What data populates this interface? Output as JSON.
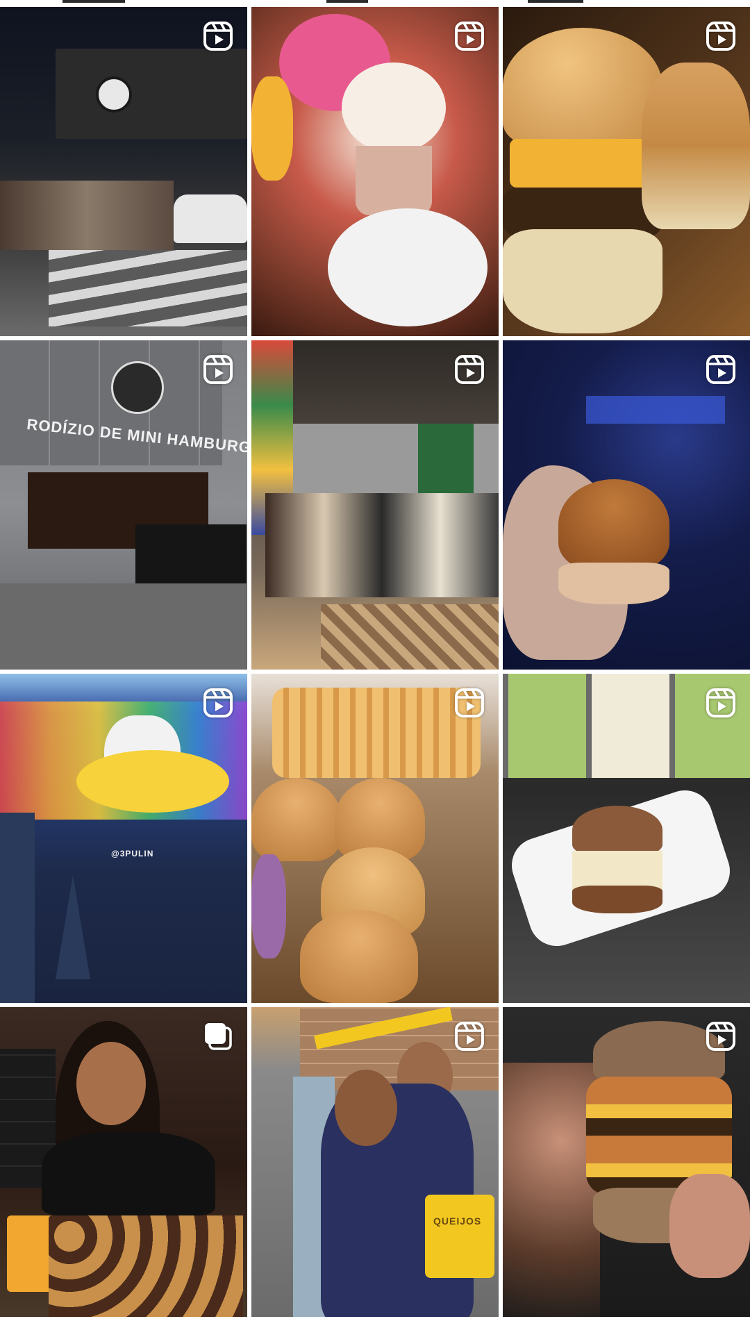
{
  "app": "Instagram profile reels grid",
  "grid": {
    "columns": 3,
    "tiles": [
      {
        "name": "tile-storefront-night",
        "badge": "reels-icon",
        "colors": [
          "#1b1f27",
          "#3a3a3a",
          "#6b6b6b"
        ]
      },
      {
        "name": "tile-milkshake-flamingo",
        "badge": "reels-icon",
        "colors": [
          "#8a3a2a",
          "#e85a8f",
          "#f4e6d8"
        ]
      },
      {
        "name": "tile-cheeseburgers-tray",
        "badge": "reels-icon",
        "colors": [
          "#3a2412",
          "#d49a45",
          "#f2b233"
        ]
      },
      {
        "name": "tile-restaurant-facade",
        "badge": "reels-icon",
        "sign_text": "RODÍZIO DE MINI HAMBURGUER",
        "colors": [
          "#5d5f63",
          "#8c8e92",
          "#2b2b2b"
        ]
      },
      {
        "name": "tile-dining-room",
        "badge": "reels-icon",
        "colors": [
          "#3a3530",
          "#7a6a5a",
          "#c9a77c"
        ]
      },
      {
        "name": "tile-mini-burger-hand",
        "badge": "reels-icon",
        "colors": [
          "#0c1230",
          "#2a3a8a",
          "#c07a3a"
        ]
      },
      {
        "name": "tile-mural-wall",
        "badge": "reels-icon",
        "mural_signature": "@3PULIN",
        "colors": [
          "#1d2a4a",
          "#2d4a9a",
          "#f7d23a"
        ]
      },
      {
        "name": "tile-burgers-and-fries",
        "badge": "reels-icon",
        "colors": [
          "#6a4a2a",
          "#d89a4a",
          "#f0c070"
        ]
      },
      {
        "name": "tile-slider-plate",
        "badge": "reels-icon",
        "colors": [
          "#2a2a2a",
          "#f5f5f5",
          "#8a5a3a"
        ]
      },
      {
        "name": "tile-woman-smiling-burgers",
        "badge": "carousel-icon",
        "colors": [
          "#2a1a14",
          "#7a4a30",
          "#e8a040"
        ]
      },
      {
        "name": "tile-hug-staff",
        "badge": "reels-icon",
        "bag_text": "QUEIJOS",
        "colors": [
          "#6a6a6a",
          "#2a3060",
          "#f2c820"
        ]
      },
      {
        "name": "tile-stacked-onion-burger",
        "badge": "reels-icon",
        "colors": [
          "#1a1a1a",
          "#c87a3a",
          "#f2c040"
        ]
      }
    ]
  }
}
